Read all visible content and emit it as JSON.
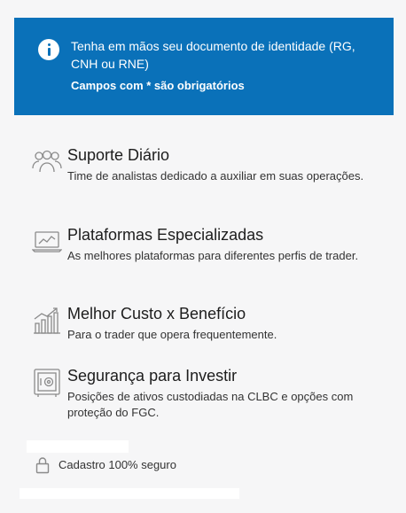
{
  "banner": {
    "message": "Tenha em mãos seu documento de identidade (RG, CNH ou RNE)",
    "required_note": "Campos com * são obrigatórios"
  },
  "features": [
    {
      "icon": "users-icon",
      "title": "Suporte Diário",
      "description": "Time de analistas dedicado a auxiliar em suas operações."
    },
    {
      "icon": "laptop-chart-icon",
      "title": "Plataformas Especializadas",
      "description": "As melhores plataformas para diferentes perfis de trader."
    },
    {
      "icon": "bar-chart-up-icon",
      "title": "Melhor Custo x Benefício",
      "description": "Para o trader que opera frequentemente."
    },
    {
      "icon": "safe-icon",
      "title": "Segurança para Investir",
      "description": "Posições de ativos custodiadas na CLBC e opções com proteção do FGC."
    }
  ],
  "secure": {
    "icon": "lock-icon",
    "label": "Cadastro 100% seguro"
  },
  "colors": {
    "banner": "#0a71b9",
    "background": "#f6f6f7",
    "icon": "#888888"
  }
}
